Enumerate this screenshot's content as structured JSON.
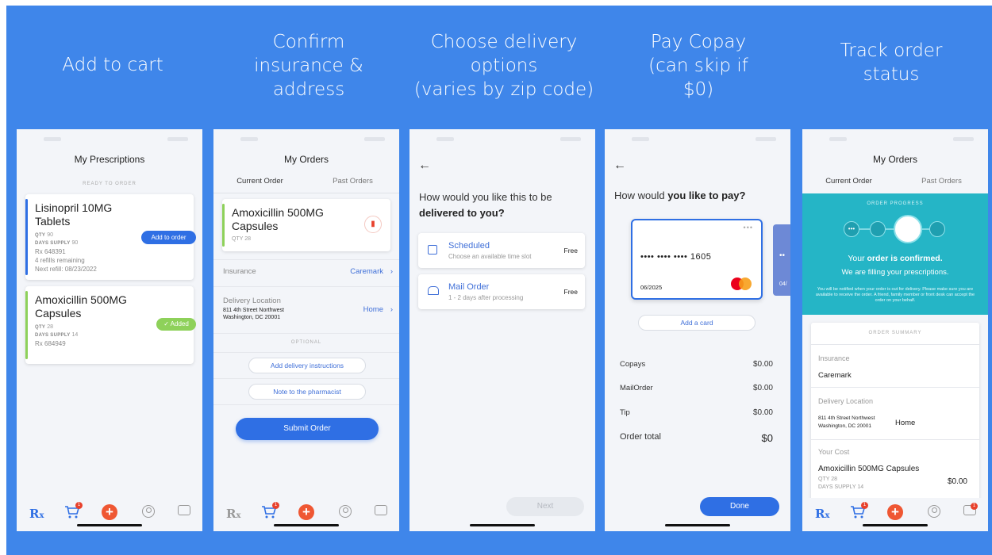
{
  "steps": [
    {
      "title": "Add to cart"
    },
    {
      "title": "Confirm\ninsurance &\naddress"
    },
    {
      "title": "Choose delivery\noptions\n(varies by zip code)"
    },
    {
      "title": "Pay Copay\n(can skip if\n$0)"
    },
    {
      "title": "Track order\nstatus"
    }
  ],
  "colors": {
    "background": "#3f86ea",
    "accent": "#2f6fe4",
    "added": "#8ed15a",
    "teal": "#25b5c6",
    "plus": "#ef5733",
    "cart_badge": "#e8412c"
  },
  "icons": {
    "nav": [
      "rx-icon",
      "cart-icon",
      "plus-icon",
      "profile-icon",
      "chat-icon"
    ]
  },
  "screen1": {
    "title": "My Prescriptions",
    "section": "READY TO ORDER",
    "rx1": {
      "name": "Lisinopril 10MG Tablets",
      "qty_label": "QTY",
      "qty": "90",
      "supply_label": "DAYS SUPPLY",
      "supply": "90",
      "rx": "Rx 648391",
      "refills": "4 refills remaining",
      "next_refill": "Next refill: 08/23/2022",
      "button": "Add to order"
    },
    "rx2": {
      "name": "Amoxicillin 500MG Capsules",
      "qty_label": "QTY",
      "qty": "28",
      "supply_label": "DAYS SUPPLY",
      "supply": "14",
      "rx": "Rx 684949",
      "badge": "Added"
    },
    "nav": {
      "rx": "R",
      "rx_sub": "x",
      "cart_badge": "1",
      "plus": "+"
    }
  },
  "screen2": {
    "title": "My Orders",
    "tabs": [
      "Current Order",
      "Past Orders"
    ],
    "item": {
      "name": "Amoxicillin 500MG Capsules",
      "qty": "QTY 28"
    },
    "insurance_label": "Insurance",
    "insurance_value": "Caremark",
    "delivery_label": "Delivery Location",
    "address_line1": "811 4th Street Northwest",
    "address_line2": "Washington, DC 20001",
    "address_tag": "Home",
    "optional": "OPTIONAL",
    "btn_instructions": "Add delivery instructions",
    "btn_note": "Note to the pharmacist",
    "submit": "Submit Order",
    "nav": {
      "rx": "R",
      "rx_sub": "x",
      "cart_badge": "1",
      "plus": "+"
    }
  },
  "screen3": {
    "question_1": "How would you like this to be",
    "question_2": "delivered to you?",
    "opt1": {
      "title": "Scheduled",
      "sub": "Choose an available time slot",
      "price": "Free"
    },
    "opt2": {
      "title": "Mail Order",
      "sub": "1 - 2 days after processing",
      "price": "Free"
    },
    "next": "Next"
  },
  "screen4": {
    "question_1": "How would ",
    "question_2": "you like to pay?",
    "card_number": "•••• •••• •••• 1605",
    "card_dots": "•••",
    "expiry": "06/2025",
    "peek_dots": "••",
    "peek_text": "04/",
    "add_card": "Add a card",
    "lines": [
      {
        "label": "Copays",
        "value": "$0.00"
      },
      {
        "label": "MailOrder",
        "value": "$0.00"
      },
      {
        "label": "Tip",
        "value": "$0.00"
      }
    ],
    "total_label": "Order total",
    "total_value": "$0",
    "done": "Done"
  },
  "screen5": {
    "title": "My Orders",
    "tabs": [
      "Current Order",
      "Past Orders"
    ],
    "progress_label": "ORDER PROGRESS",
    "progress_icons": [
      "dots-icon",
      "box-icon",
      "paper-icon",
      "package-icon"
    ],
    "confirm_1": "Your ",
    "confirm_2": "order is confirmed.",
    "filling": "We are filling your prescriptions.",
    "notice": "You will be notified when your order is out for delivery. Please make sure you are available to receive the order. A friend, family member or front desk can accept the order on your behalf.",
    "summary_label": "ORDER SUMMARY",
    "insurance_label": "Insurance",
    "insurance_value": "Caremark",
    "delivery_label": "Delivery Location",
    "address_line1": "811 4th Street Northwest",
    "address_line2": "Washington, DC 20001",
    "address_tag": "Home",
    "cost_label": "Your Cost",
    "item_name": "Amoxicillin 500MG Capsules",
    "qty": "QTY 28",
    "supply": "DAYS SUPPLY 14",
    "price": "$0.00",
    "nav": {
      "rx": "R",
      "rx_sub": "x",
      "cart_badge": "1",
      "chat_badge": "1",
      "plus": "+"
    }
  }
}
